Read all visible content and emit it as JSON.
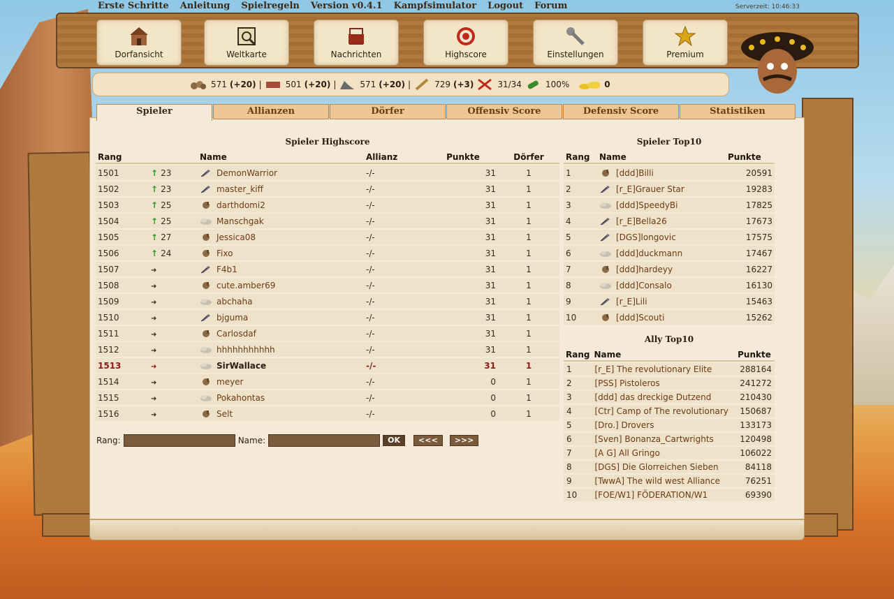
{
  "topnav": [
    "Erste Schritte",
    "Anleitung",
    "Spielregeln",
    "Version v0.4.1",
    "Kampfsimulator",
    "Logout",
    "Forum"
  ],
  "server_time": "Serverzeit: 10:46:33",
  "nav": [
    {
      "label": "Dorfansicht",
      "icon": "village-icon"
    },
    {
      "label": "Weltkarte",
      "icon": "map-icon"
    },
    {
      "label": "Nachrichten",
      "icon": "messages-icon"
    },
    {
      "label": "Highscore",
      "icon": "target-icon"
    },
    {
      "label": "Einstellungen",
      "icon": "wrench-icon"
    },
    {
      "label": "Premium",
      "icon": "star-icon"
    }
  ],
  "resources": {
    "wood": {
      "value": "571",
      "delta": "(+20)"
    },
    "brick": {
      "value": "501",
      "delta": "(+20)"
    },
    "iron": {
      "value": "571",
      "delta": "(+20)"
    },
    "wheat": {
      "value": "729",
      "delta": "(+3)"
    },
    "units": "31/34",
    "loyalty": "100%",
    "gold": "0"
  },
  "tabs": [
    "Spieler",
    "Allianzen",
    "Dörfer",
    "Offensiv Score",
    "Defensiv Score",
    "Statistiken"
  ],
  "highscore": {
    "title": "Spieler Highscore",
    "headers": [
      "Rang",
      "Name",
      "Allianz",
      "Punkte",
      "Dörfer"
    ],
    "rows": [
      {
        "rank": "1501",
        "trend": "up",
        "change": "23",
        "icon": "feather",
        "name": "DemonWarrior",
        "ally": "-/-",
        "points": "31",
        "villages": "1"
      },
      {
        "rank": "1502",
        "trend": "up",
        "change": "23",
        "icon": "feather",
        "name": "master_kiff",
        "ally": "-/-",
        "points": "31",
        "villages": "1"
      },
      {
        "rank": "1503",
        "trend": "up",
        "change": "25",
        "icon": "hand",
        "name": "darthdomi2",
        "ally": "-/-",
        "points": "31",
        "villages": "1"
      },
      {
        "rank": "1504",
        "trend": "up",
        "change": "25",
        "icon": "cloud",
        "name": "Manschgak",
        "ally": "-/-",
        "points": "31",
        "villages": "1"
      },
      {
        "rank": "1505",
        "trend": "up",
        "change": "27",
        "icon": "hand",
        "name": "Jessica08",
        "ally": "-/-",
        "points": "31",
        "villages": "1"
      },
      {
        "rank": "1506",
        "trend": "up",
        "change": "24",
        "icon": "hand",
        "name": "Fixo",
        "ally": "-/-",
        "points": "31",
        "villages": "1"
      },
      {
        "rank": "1507",
        "trend": "same",
        "change": "",
        "icon": "feather",
        "name": "F4b1",
        "ally": "-/-",
        "points": "31",
        "villages": "1"
      },
      {
        "rank": "1508",
        "trend": "same",
        "change": "",
        "icon": "hand",
        "name": "cute.amber69",
        "ally": "-/-",
        "points": "31",
        "villages": "1"
      },
      {
        "rank": "1509",
        "trend": "same",
        "change": "",
        "icon": "cloud",
        "name": "abchaha",
        "ally": "-/-",
        "points": "31",
        "villages": "1"
      },
      {
        "rank": "1510",
        "trend": "same",
        "change": "",
        "icon": "feather",
        "name": "bjguma",
        "ally": "-/-",
        "points": "31",
        "villages": "1"
      },
      {
        "rank": "1511",
        "trend": "same",
        "change": "",
        "icon": "hand",
        "name": "Carlosdaf",
        "ally": "-/-",
        "points": "31",
        "villages": "1"
      },
      {
        "rank": "1512",
        "trend": "same",
        "change": "",
        "icon": "cloud",
        "name": "hhhhhhhhhhh",
        "ally": "-/-",
        "points": "31",
        "villages": "1"
      },
      {
        "rank": "1513",
        "trend": "same",
        "change": "",
        "icon": "cloud",
        "name": "SirWallace",
        "ally": "-/-",
        "points": "31",
        "villages": "1",
        "me": true
      },
      {
        "rank": "1514",
        "trend": "same",
        "change": "",
        "icon": "hand",
        "name": "meyer",
        "ally": "-/-",
        "points": "0",
        "villages": "1"
      },
      {
        "rank": "1515",
        "trend": "same",
        "change": "",
        "icon": "cloud",
        "name": "Pokahontas",
        "ally": "-/-",
        "points": "0",
        "villages": "1"
      },
      {
        "rank": "1516",
        "trend": "same",
        "change": "",
        "icon": "hand",
        "name": "Selt",
        "ally": "-/-",
        "points": "0",
        "villages": "1"
      }
    ]
  },
  "search": {
    "rang_label": "Rang:",
    "name_label": "Name:",
    "ok": "OK",
    "prev": "<<<",
    "next": ">>>"
  },
  "top10": {
    "title": "Spieler Top10",
    "headers": [
      "Rang",
      "Name",
      "Punkte"
    ],
    "rows": [
      {
        "rank": "1",
        "icon": "hand",
        "name": "[ddd]Billi",
        "points": "20591"
      },
      {
        "rank": "2",
        "icon": "feather",
        "name": "[r_E]Grauer Star",
        "points": "19283"
      },
      {
        "rank": "3",
        "icon": "cloud",
        "name": "[ddd]SpeedyBi",
        "points": "17825"
      },
      {
        "rank": "4",
        "icon": "feather",
        "name": "[r_E]Bella26",
        "points": "17673"
      },
      {
        "rank": "5",
        "icon": "feather",
        "name": "[DGS]longovic",
        "points": "17575"
      },
      {
        "rank": "6",
        "icon": "cloud",
        "name": "[ddd]duckmann",
        "points": "17467"
      },
      {
        "rank": "7",
        "icon": "hand",
        "name": "[ddd]hardeyy",
        "points": "16227"
      },
      {
        "rank": "8",
        "icon": "cloud",
        "name": "[ddd]Consalo",
        "points": "16130"
      },
      {
        "rank": "9",
        "icon": "feather",
        "name": "[r_E]Lili",
        "points": "15463"
      },
      {
        "rank": "10",
        "icon": "hand",
        "name": "[ddd]Scouti",
        "points": "15262"
      }
    ]
  },
  "allytop10": {
    "title": "Ally Top10",
    "headers": [
      "Rang",
      "Name",
      "Punkte"
    ],
    "rows": [
      {
        "rank": "1",
        "name": "[r_E] The revolutionary Elite",
        "points": "288164"
      },
      {
        "rank": "2",
        "name": "[PSS] Pistoleros",
        "points": "241272"
      },
      {
        "rank": "3",
        "name": "[ddd] das dreckige Dutzend",
        "points": "210430"
      },
      {
        "rank": "4",
        "name": "[Ctr] Camp of The revolutionary",
        "points": "150687"
      },
      {
        "rank": "5",
        "name": "[Dro.] Drovers",
        "points": "133173"
      },
      {
        "rank": "6",
        "name": "[Sven] Bonanza_Cartwrights",
        "points": "120498"
      },
      {
        "rank": "7",
        "name": "[A G] All Gringo",
        "points": "106022"
      },
      {
        "rank": "8",
        "name": "[DGS] Die Glorreichen Sieben",
        "points": "84118"
      },
      {
        "rank": "9",
        "name": "[TwwA] The wild west Alliance",
        "points": "76251"
      },
      {
        "rank": "10",
        "name": "[FOE/W1] FÖDERATION/W1",
        "points": "69390"
      }
    ]
  }
}
